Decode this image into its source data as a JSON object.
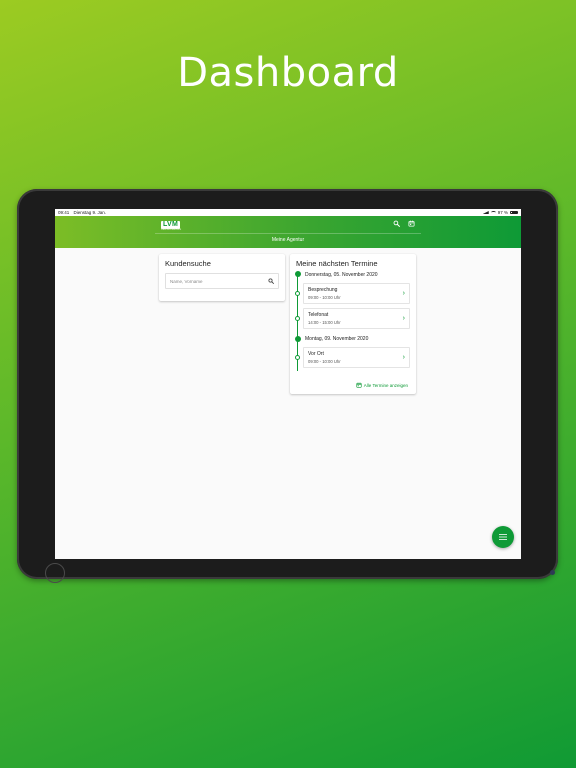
{
  "headline": "Dashboard",
  "statusbar": {
    "time": "09:41",
    "date": "Dienstag 9. Jan.",
    "battery": "97 %"
  },
  "appbar": {
    "logo_text": "LVM",
    "logo_subtitle": "VERSICHERUNG",
    "title": "Meine Agentur",
    "icons": [
      "search-icon",
      "calendar-icon"
    ]
  },
  "search_card": {
    "title": "Kundensuche",
    "placeholder": "Name, Vorname"
  },
  "appointments_card": {
    "title": "Meine nächsten Termine",
    "days": [
      {
        "date": "Donnerstag, 05. November 2020",
        "items": [
          {
            "title": "Besprechung",
            "time": "09:00 - 10:00 Uhr"
          },
          {
            "title": "Telefonat",
            "time": "14:00 - 15:00 Uhr"
          }
        ]
      },
      {
        "date": "Montag, 09. November 2020",
        "items": [
          {
            "title": "Vor Ort",
            "time": "09:00 - 10:00 Uhr"
          }
        ]
      }
    ],
    "all_link": "Alle Termine anzeigen"
  },
  "fab": {
    "icon": "menu-icon"
  },
  "colors": {
    "brand_green": "#0e9a36",
    "light_green": "#9ccb22"
  }
}
